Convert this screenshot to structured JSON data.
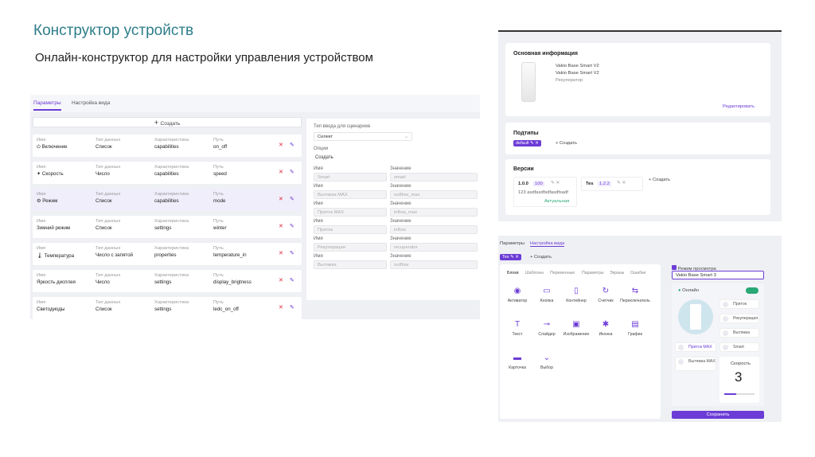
{
  "slide": {
    "title": "Конструктор устройств",
    "subtitle": "Онлайн-конструктор для настройки управления устройством"
  },
  "left_panel": {
    "tabs": [
      "Параметры",
      "Настройка вида"
    ],
    "create_label": "Создать",
    "col_name": "Имя",
    "col_type": "Тип данных",
    "col_char": "Характеристика",
    "col_path": "Путь",
    "rows": [
      {
        "name": "Включение",
        "type": "Список",
        "char": "capabilities",
        "path": "on_off"
      },
      {
        "name": "Скорость",
        "type": "Число",
        "char": "capabilities",
        "path": "speed"
      },
      {
        "name": "Режим",
        "type": "Список",
        "char": "capabilities",
        "path": "mode"
      },
      {
        "name": "Зимний режим",
        "type": "Список",
        "char": "settings",
        "path": "winter"
      },
      {
        "name": "Температура",
        "type": "Число с запятой",
        "char": "properties",
        "path": "temperature_in"
      },
      {
        "name": "Яркость дисплея",
        "type": "Число",
        "char": "settings",
        "path": "display_brigtness"
      },
      {
        "name": "Светодиоды",
        "type": "Список",
        "char": "settings",
        "path": "ledc_on_off"
      }
    ],
    "options": {
      "input_type_label": "Тип ввода для сценариев",
      "input_type_value": "Селект",
      "options_label": "Опции",
      "create_label": "Создать",
      "name_label": "Имя",
      "value_label": "Значение",
      "pairs": [
        {
          "name": "Smart",
          "value": "smart"
        },
        {
          "name": "Вытяжка MAX",
          "value": "outflow_max"
        },
        {
          "name": "Приток MAX",
          "value": "inflow_max"
        },
        {
          "name": "Приток",
          "value": "inflow"
        },
        {
          "name": "Рекуперация",
          "value": "recuperator"
        },
        {
          "name": "Вытяжка",
          "value": "outflow"
        }
      ]
    }
  },
  "right_top": {
    "basic_info_title": "Основная информация",
    "device_line1": "Vakio Base Smart V2",
    "device_line2": "Vakio Base Smart V2",
    "device_line3": "Рекуператор",
    "edit_label": "Редактировать",
    "subtypes_title": "Подтипы",
    "subtype_chip": "default",
    "create_label": "Создать",
    "versions_title": "Версии",
    "version1": "1.0.0",
    "version1_tag": "100",
    "version1_hash": "123 asdfasdfsdfasdfsadf",
    "version1_status": "Актуальная",
    "version2": "Tes",
    "version2_tag": "1.2.2"
  },
  "right_bottom": {
    "tabs": [
      "Параметры",
      "Настройка вида"
    ],
    "chip": "Tes",
    "create_label": "Создать",
    "subtabs": [
      "Блоки",
      "Шаблоны",
      "Переменные",
      "Параметры",
      "Экраны",
      "Ошибки"
    ],
    "widgets": [
      "Активатор",
      "Кнопка",
      "Контейнер",
      "Счетчик",
      "Переключатель",
      "Текст",
      "Слайдер",
      "Изображение",
      "Иконка",
      "График",
      "Карточка",
      "Выбор"
    ],
    "preview_label": "Режим просмотра",
    "preview_value": "Vakio Base Smart 3",
    "online_label": "Онлайн",
    "modes": [
      "Приток",
      "Рекуперация",
      "Вытяжка",
      "Smart"
    ],
    "mode_left1": "Приток MAX",
    "mode_left2": "Вытяжка MAX",
    "speed_label": "Скорость",
    "speed_value": "3",
    "save_label": "Сохранить"
  }
}
